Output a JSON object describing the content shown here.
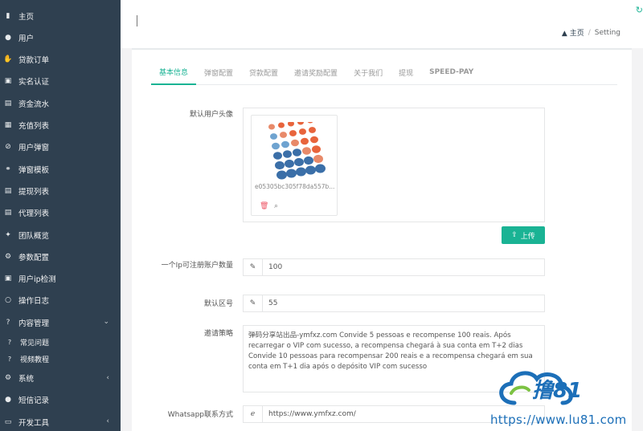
{
  "sidebar": {
    "items": [
      {
        "label": "主页",
        "icon": "bar-chart-icon",
        "glyph": "▮"
      },
      {
        "label": "用户",
        "icon": "user-icon",
        "glyph": "●"
      },
      {
        "label": "贷款订单",
        "icon": "handshake-icon",
        "glyph": "✋"
      },
      {
        "label": "实名认证",
        "icon": "id-card-icon",
        "glyph": "▣"
      },
      {
        "label": "资金流水",
        "icon": "money-icon",
        "glyph": "▤"
      },
      {
        "label": "充值列表",
        "icon": "list-icon",
        "glyph": "▦"
      },
      {
        "label": "用户弹窗",
        "icon": "ban-icon",
        "glyph": "⊘"
      },
      {
        "label": "弹窗模板",
        "icon": "link-icon",
        "glyph": "⚭"
      },
      {
        "label": "提现列表",
        "icon": "list-alt-icon",
        "glyph": "▤"
      },
      {
        "label": "代理列表",
        "icon": "list-alt-icon",
        "glyph": "▤"
      },
      {
        "label": "团队概览",
        "icon": "users-icon",
        "glyph": "✦"
      },
      {
        "label": "参数配置",
        "icon": "cogs-icon",
        "glyph": "⚙"
      },
      {
        "label": "用户ip检测",
        "icon": "id-badge-icon",
        "glyph": "▣"
      },
      {
        "label": "操作日志",
        "icon": "circle-icon",
        "glyph": "○"
      },
      {
        "label": "内容管理",
        "icon": "question-circle-icon",
        "glyph": "?",
        "arrow": "⌄"
      },
      {
        "label": "常见问题",
        "icon": "question-icon",
        "glyph": "?",
        "sub": true
      },
      {
        "label": "视频教程",
        "icon": "question-icon",
        "glyph": "?",
        "sub": true
      },
      {
        "label": "系统",
        "icon": "gear-icon",
        "glyph": "⚙",
        "arrow": "‹"
      },
      {
        "label": "短信记录",
        "icon": "comment-icon",
        "glyph": "●"
      },
      {
        "label": "开发工具",
        "icon": "keyboard-icon",
        "glyph": "▭",
        "arrow": "‹"
      }
    ]
  },
  "breadcrumb": {
    "home": "主页",
    "sep": "/",
    "current": "Setting"
  },
  "tabs": [
    "基本信息",
    "弹窗配置",
    "贷款配置",
    "邀请奖励配置",
    "关于我们",
    "提现",
    "SPEED-PAY"
  ],
  "form": {
    "avatar_label": "默认用户头像",
    "avatar_filename": "e05305bc305f78da557b...",
    "upload_label": "上传",
    "ip_limit_label": "一个Ip可注册账户数量",
    "ip_limit_value": "100",
    "area_code_label": "默认区号",
    "area_code_value": "55",
    "invite_label": "邀请策略",
    "invite_text_1": "弹码分享站出品-ymfxz.com Convide 5 pessoas e recompense 100 reais. Após recarregar o VIP com sucesso, a recompensa chegará à sua conta em T+2 dias",
    "invite_text_2": "Convide 10 pessoas para recompensar 200 reais e a recompensa chegará em sua conta em T+1 dia após o depósito VIP com sucesso",
    "whatsapp_label": "Whatsapp联系方式",
    "whatsapp_value": "https://www.ymfxz.com/"
  },
  "watermark": {
    "logo": "撸81",
    "url": "https://www.lu81.com"
  },
  "colors": {
    "sidebar": "#2f4050",
    "accent": "#1ab394",
    "danger": "#ed5565"
  }
}
